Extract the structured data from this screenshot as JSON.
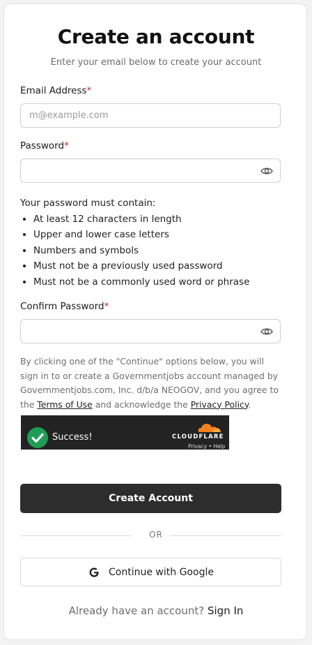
{
  "header": {
    "title": "Create an account",
    "subtitle": "Enter your email below to create your account"
  },
  "email": {
    "label": "Email Address",
    "required_mark": "*",
    "placeholder": "m@example.com",
    "value": ""
  },
  "password": {
    "label": "Password",
    "required_mark": "*",
    "value": "",
    "toggle_icon": "eye-icon"
  },
  "password_rules": {
    "title": "Your password must contain:",
    "items": [
      "At least 12 characters in length",
      "Upper and lower case letters",
      "Numbers and symbols",
      "Must not be a previously used password",
      "Must not be a commonly used word or phrase"
    ]
  },
  "confirm_password": {
    "label": "Confirm Password",
    "required_mark": "*",
    "value": "",
    "toggle_icon": "eye-icon"
  },
  "consent": {
    "text_before": "By clicking one of the \"Continue\" options below, you will sign in to or create a Governmentjobs account managed by Governmentjobs.com, Inc. d/b/a NEOGOV, and you agree to the ",
    "terms_link": "Terms of Use",
    "text_middle": " and acknowledge the ",
    "privacy_link": "Privacy Policy",
    "text_after": "."
  },
  "captcha": {
    "status": "Success!",
    "brand": "CLOUDFLARE",
    "links": "Privacy • Help",
    "status_color": "#1f9d55",
    "brand_color": "#f38020"
  },
  "actions": {
    "create_account": "Create Account",
    "divider": "OR",
    "google": "Continue with Google"
  },
  "footer": {
    "prompt": "Already have an account?",
    "sign_in": "Sign In"
  }
}
